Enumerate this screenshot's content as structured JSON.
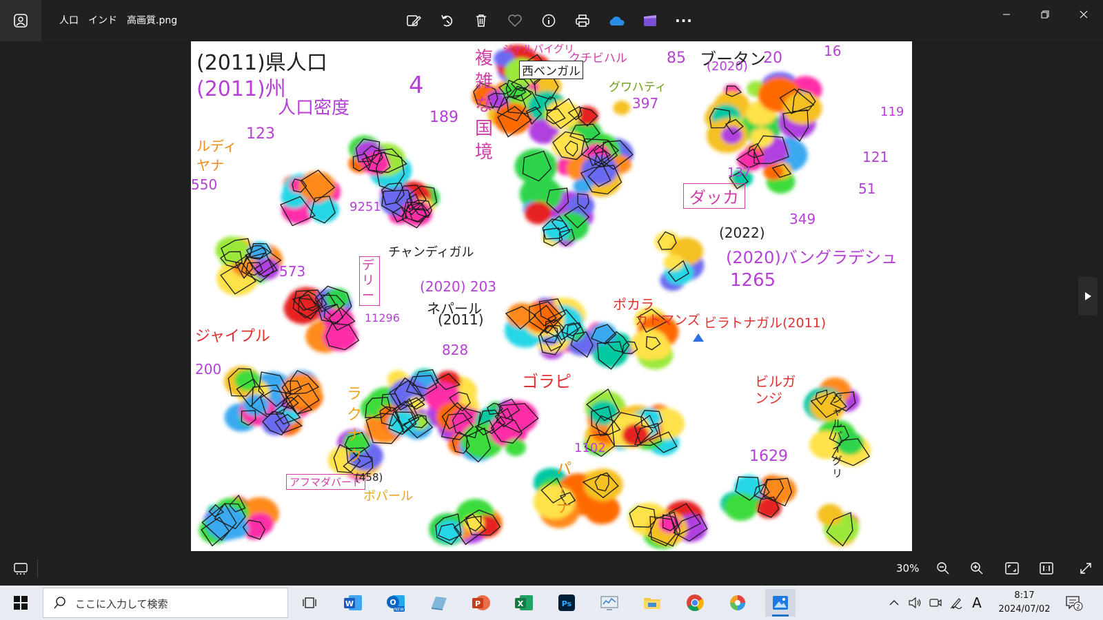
{
  "window": {
    "title": "人口　インド　高画質.png",
    "toolbar": [
      {
        "id": "edit",
        "icon": "edit-image-icon"
      },
      {
        "id": "rotate",
        "icon": "rotate-icon"
      },
      {
        "id": "delete",
        "icon": "trash-icon"
      },
      {
        "id": "favorite",
        "icon": "heart-icon"
      },
      {
        "id": "info",
        "icon": "info-icon"
      },
      {
        "id": "print",
        "icon": "printer-icon"
      },
      {
        "id": "onedrive",
        "icon": "onedrive-cloud-icon"
      },
      {
        "id": "clipchamp",
        "icon": "video-editor-icon"
      },
      {
        "id": "more",
        "icon": "more-icon"
      }
    ],
    "more_label": "···"
  },
  "viewer": {
    "zoom": "30%"
  },
  "image": {
    "annotations": {
      "a1": "(2011)県人口",
      "a2": "(2011)州",
      "a3": "人口密度",
      "a4": "複",
      "a5": "雑",
      "a6": "な",
      "a7": "国",
      "a8": "境",
      "a9": "ジャルパイグリ",
      "a10": "クチビハル",
      "a11": "西ベンガル",
      "a12": "85",
      "a13": "ブータン",
      "a14": "(2020)",
      "a15": "20",
      "a16": "16",
      "a17": "グワハティ",
      "a18": "397",
      "a19": "4",
      "a20": "189",
      "a21": "ルディヤナ",
      "a22": "123",
      "a23": "550",
      "a24": "ダッカ",
      "a25": "(2022)",
      "a26": "(2020)バングラデシュ",
      "a27": "1265",
      "a28": "9251",
      "a29": "チャンディガル",
      "a30": "デリー",
      "a31": "11296",
      "a32": "573",
      "a33": "ジャイプル",
      "a34": "200",
      "a35": "(2020) 203",
      "a36": "ネパール",
      "a37": "(2011)",
      "a38": "828",
      "a39": "ポカラ",
      "a40": "カトマンズ",
      "a41": "ビラトナガル(2011)",
      "a42": "ゴラピ",
      "a43": "ビルガンジ",
      "a44": "ラクナウ",
      "a45": "アフマダバード",
      "a46": "(458)",
      "a47": "ボパール",
      "a48": "1102",
      "a49": "パトナ",
      "a50": "1629",
      "a51": "ジャルパイグリ",
      "a52": "349",
      "a53": "121",
      "a54": "51",
      "a55": "137",
      "a56": "119"
    }
  }
}
